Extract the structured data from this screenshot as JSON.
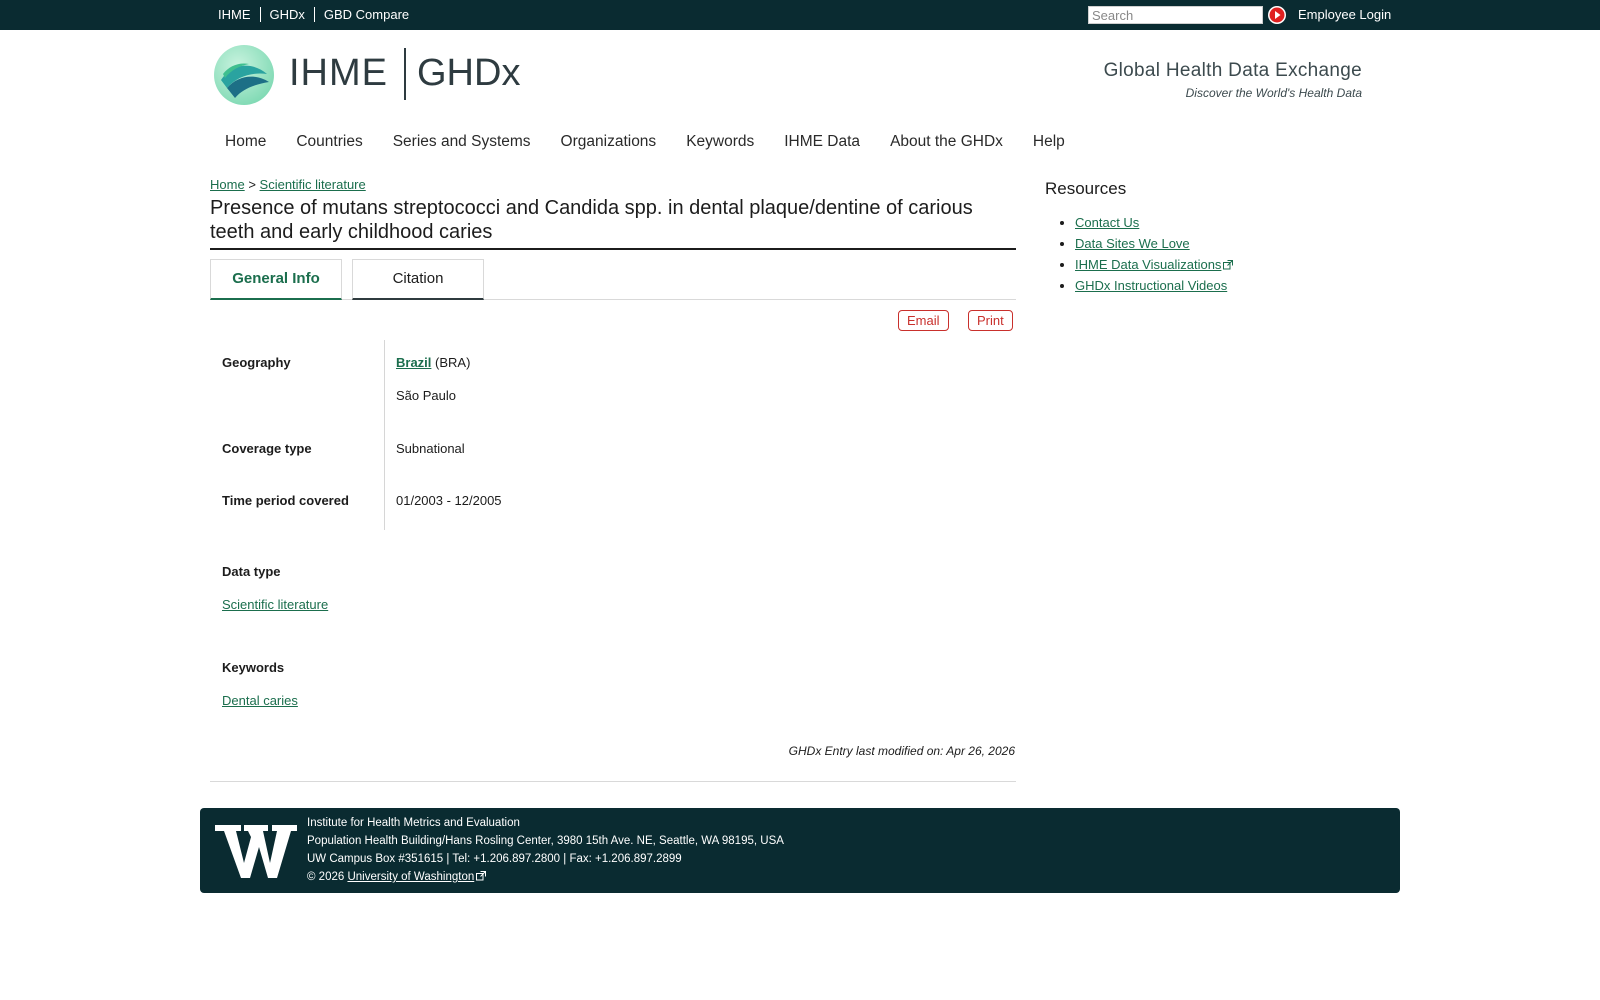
{
  "topbar": {
    "links": [
      "IHME",
      "GHDx",
      "GBD Compare"
    ],
    "search_placeholder": "Search",
    "employee_login": "Employee Login"
  },
  "header": {
    "logo_left": "IHME",
    "logo_right": "GHDx",
    "site_title": "Global Health Data Exchange",
    "tagline": "Discover the World's Health Data"
  },
  "nav": {
    "items": [
      "Home",
      "Countries",
      "Series and Systems",
      "Organizations",
      "Keywords",
      "IHME Data",
      "About the GHDx",
      "Help"
    ]
  },
  "breadcrumb": {
    "home": "Home",
    "separator": ">",
    "current": "Scientific literature"
  },
  "page": {
    "title": "Presence of mutans streptococci and Candida spp. in dental plaque/dentine of carious teeth and early childhood caries"
  },
  "tabs": {
    "general": "General Info",
    "citation": "Citation"
  },
  "actions": {
    "email": "Email",
    "print": "Print"
  },
  "info": {
    "geography_label": "Geography",
    "geography_country": "Brazil",
    "geography_code": "(BRA)",
    "geography_region": "São Paulo",
    "coverage_label": "Coverage type",
    "coverage_value": "Subnational",
    "time_label": "Time period covered",
    "time_value": "01/2003 - 12/2005",
    "data_type_label": "Data type",
    "data_type_value": "Scientific literature",
    "keywords_label": "Keywords",
    "keywords_value": "Dental caries",
    "last_modified": "GHDx Entry last modified on: Apr 26, 2026"
  },
  "sidebar": {
    "title": "Resources",
    "links": [
      "Contact Us",
      "Data Sites We Love",
      "IHME Data Visualizations",
      "GHDx Instructional Videos"
    ]
  },
  "footer": {
    "line1": "Institute for Health Metrics and Evaluation",
    "line2": "Population Health Building/Hans Rosling Center, 3980 15th Ave. NE, Seattle, WA 98195, USA",
    "line3": "UW Campus Box #351615 | Tel: +1.206.897.2800 | Fax: +1.206.897.2899",
    "copyright": "© 2026",
    "university": "University of Washington"
  },
  "colors": {
    "dark_bar": "#0a2b31",
    "link_green": "#1b6e4d",
    "action_red": "#c9302c"
  }
}
